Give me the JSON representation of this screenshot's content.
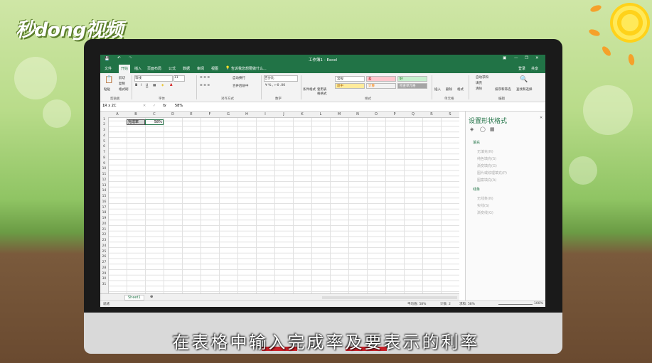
{
  "brand": {
    "logo": "秒dong视频"
  },
  "excel": {
    "title": "工作簿1 - Excel",
    "signin": "登录",
    "share": "共享",
    "tabs": [
      "文件",
      "开始",
      "插入",
      "页面布局",
      "公式",
      "数据",
      "审阅",
      "视图"
    ],
    "tell_me": "告诉我您想要做什么...",
    "ribbon": {
      "clipboard": {
        "paste": "粘贴",
        "cut": "剪切",
        "copy": "复制",
        "format_painter": "格式刷",
        "group": "剪贴板"
      },
      "font": {
        "name": "等线",
        "size": "11",
        "group": "字体"
      },
      "alignment": {
        "wrap": "自动换行",
        "merge": "合并后居中",
        "group": "对齐方式"
      },
      "number": {
        "format": "百分比",
        "group": "数字"
      },
      "styles": {
        "cond": "条件格式",
        "table": "套用表格格式",
        "normal": "常规",
        "bad": "差",
        "good": "好",
        "neutral": "适中",
        "calc": "计算",
        "check": "检查单元格",
        "group": "样式"
      },
      "cells": {
        "insert": "插入",
        "delete": "删除",
        "format": "格式",
        "group": "单元格"
      },
      "editing": {
        "autosum": "自动求和",
        "fill": "填充",
        "clear": "清除",
        "sort": "排序和筛选",
        "find": "查找和选择",
        "group": "编辑"
      }
    },
    "namebox": "1R x 2C",
    "formula": "58%",
    "fx": "fx",
    "columns": [
      "A",
      "B",
      "C",
      "D",
      "E",
      "F",
      "G",
      "H",
      "I",
      "J",
      "K",
      "L",
      "M",
      "N",
      "O",
      "P",
      "Q",
      "R",
      "S"
    ],
    "rows": [
      "1",
      "2",
      "3",
      "4",
      "5",
      "6",
      "7",
      "8",
      "9",
      "10",
      "11",
      "12",
      "13",
      "14",
      "15",
      "16",
      "17",
      "18",
      "19",
      "20",
      "21",
      "22",
      "23",
      "24",
      "25",
      "26",
      "27",
      "28",
      "29",
      "30",
      "31"
    ],
    "cells": {
      "B1": "完成率",
      "C1": "58%"
    },
    "pane": {
      "title": "设置形状格式",
      "fill_section": "填充",
      "fill_opts": [
        "无填充(N)",
        "纯色填充(S)",
        "渐变填充(G)",
        "图片或纹理填充(P)",
        "图案填充(A)"
      ],
      "line_section": "线条",
      "line_opts": [
        "无线条(N)",
        "实线(S)",
        "渐变线(G)"
      ]
    },
    "sheet": "Sheet1",
    "status": {
      "ready": "就绪",
      "average": "平均值: 58%",
      "count": "计数: 2",
      "sum": "求和: 58%",
      "zoom": "100%"
    }
  },
  "caption": "在表格中输入完成率及要表示的利率"
}
